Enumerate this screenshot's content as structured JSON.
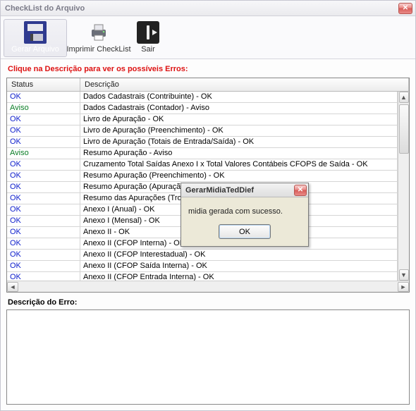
{
  "window": {
    "title": "CheckList do Arquivo"
  },
  "toolbar": {
    "gerar": "Gerar Arquivo",
    "imprimir": "Imprimir CheckList",
    "sair": "Sair"
  },
  "hint": "Clique na Descrição para ver os possíveis Erros:",
  "columns": {
    "status": "Status",
    "descricao": "Descrição"
  },
  "rows": [
    {
      "status": "OK",
      "desc": "Dados Cadastrais (Contribuinte) - OK"
    },
    {
      "status": "Aviso",
      "desc": "Dados Cadastrais (Contador) - Aviso"
    },
    {
      "status": "OK",
      "desc": "Livro de Apuração - OK"
    },
    {
      "status": "OK",
      "desc": "Livro de Apuração (Preenchimento) - OK"
    },
    {
      "status": "OK",
      "desc": "Livro de Apuração (Totais de Entrada/Saída) - OK"
    },
    {
      "status": "Aviso",
      "desc": "Resumo Apuração - Aviso"
    },
    {
      "status": "OK",
      "desc": "Cruzamento Total Saídas Anexo I x Total Valores Contábeis CFOPS de Saída - OK"
    },
    {
      "status": "OK",
      "desc": "Resumo Apuração (Preenchimento) - OK"
    },
    {
      "status": "OK",
      "desc": "Resumo Apuração (Apuração) - OK"
    },
    {
      "status": "OK",
      "desc": "Resumo das Apurações (Trocas) - OK"
    },
    {
      "status": "OK",
      "desc": "Anexo I (Anual) - OK"
    },
    {
      "status": "OK",
      "desc": "Anexo I (Mensal) - OK"
    },
    {
      "status": "OK",
      "desc": "Anexo II - OK"
    },
    {
      "status": "OK",
      "desc": "Anexo II (CFOP Interna) - OK"
    },
    {
      "status": "OK",
      "desc": "Anexo II (CFOP Interestadual) - OK"
    },
    {
      "status": "OK",
      "desc": "Anexo II (CFOP Saída Interna) - OK"
    },
    {
      "status": "OK",
      "desc": "Anexo II (CFOP Entrada Interna) - OK"
    }
  ],
  "error_label": "Descrição do Erro:",
  "modal": {
    "title": "GerarMidiaTedDief",
    "message": "midia gerada com sucesso.",
    "ok": "OK"
  }
}
